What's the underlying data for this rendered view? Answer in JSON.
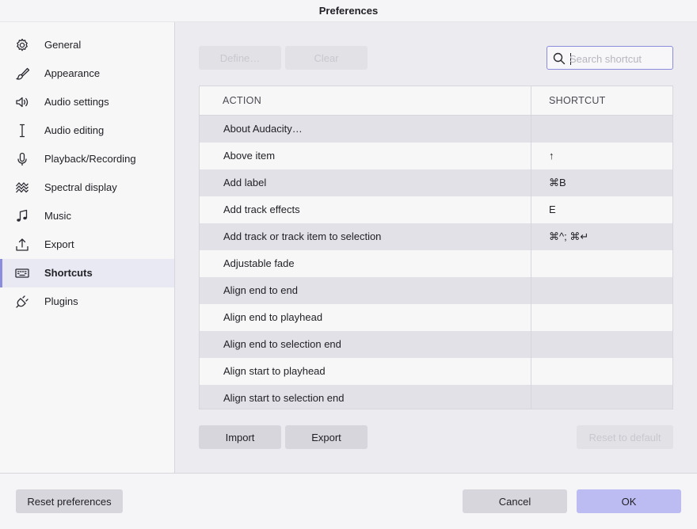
{
  "window": {
    "title": "Preferences"
  },
  "sidebar": {
    "items": [
      {
        "label": "General",
        "icon": "gear-icon"
      },
      {
        "label": "Appearance",
        "icon": "paintbrush-icon"
      },
      {
        "label": "Audio settings",
        "icon": "speaker-icon"
      },
      {
        "label": "Audio editing",
        "icon": "text-cursor-icon"
      },
      {
        "label": "Playback/Recording",
        "icon": "microphone-icon"
      },
      {
        "label": "Spectral display",
        "icon": "spectral-waves-icon"
      },
      {
        "label": "Music",
        "icon": "music-note-icon"
      },
      {
        "label": "Export",
        "icon": "export-icon"
      },
      {
        "label": "Shortcuts",
        "icon": "keyboard-icon",
        "active": true
      },
      {
        "label": "Plugins",
        "icon": "plug-icon"
      }
    ]
  },
  "toolbar": {
    "define_label": "Define…",
    "clear_label": "Clear",
    "search_placeholder": "Search shortcut",
    "search_value": ""
  },
  "table": {
    "headers": {
      "action": "ACTION",
      "shortcut": "SHORTCUT"
    },
    "rows": [
      {
        "action": "About Audacity…",
        "shortcut": ""
      },
      {
        "action": "Above item",
        "shortcut": "↑"
      },
      {
        "action": "Add label",
        "shortcut": "⌘B"
      },
      {
        "action": "Add track effects",
        "shortcut": "E"
      },
      {
        "action": "Add track or track item to selection",
        "shortcut": "⌘^; ⌘↵"
      },
      {
        "action": "Adjustable fade",
        "shortcut": ""
      },
      {
        "action": "Align end to end",
        "shortcut": ""
      },
      {
        "action": "Align end to playhead",
        "shortcut": ""
      },
      {
        "action": "Align end to selection end",
        "shortcut": ""
      },
      {
        "action": "Align start to playhead",
        "shortcut": ""
      },
      {
        "action": "Align start to selection end",
        "shortcut": ""
      }
    ]
  },
  "actions": {
    "import_label": "Import",
    "export_label": "Export",
    "reset_default_label": "Reset to default"
  },
  "footer": {
    "reset_prefs_label": "Reset preferences",
    "cancel_label": "Cancel",
    "ok_label": "OK"
  },
  "colors": {
    "accent": "#8c8cdc",
    "primary_button": "#bcbcf2",
    "selected_row": "#e9e9f4"
  }
}
